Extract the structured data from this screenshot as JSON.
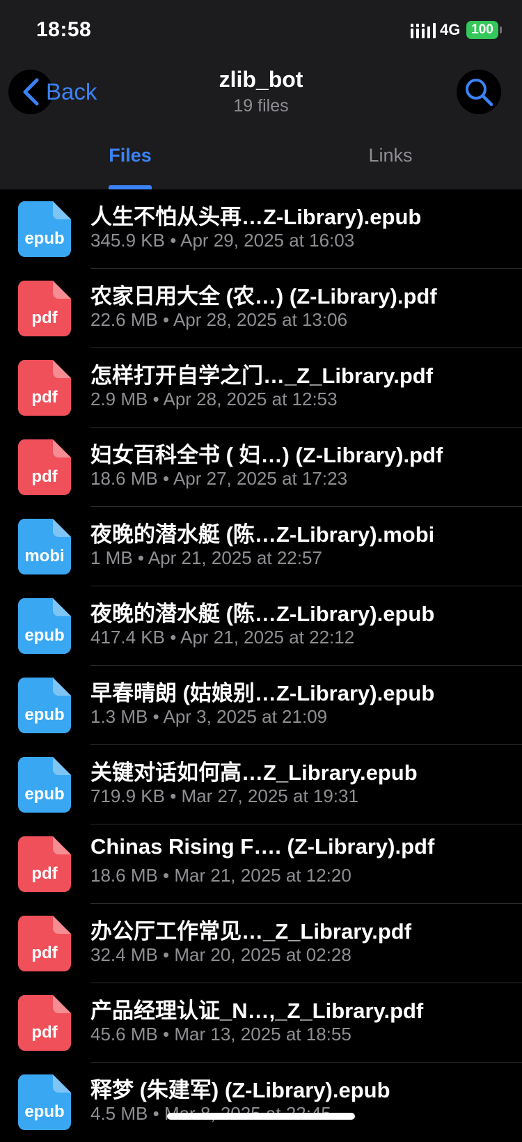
{
  "status_bar": {
    "time": "18:58",
    "network": "4G",
    "battery": "100"
  },
  "nav": {
    "back_label": "Back",
    "title": "zlib_bot",
    "subtitle": "19 files"
  },
  "tabs": [
    {
      "label": "Files",
      "active": true
    },
    {
      "label": "Links",
      "active": false
    }
  ],
  "colors": {
    "accent": "#3b82f6",
    "epub_icon": "#3aa7f2",
    "pdf_icon": "#f0505a"
  },
  "files": [
    {
      "ext": "epub",
      "name": "人生不怕从头再…Z-Library).epub",
      "size": "345.9 KB",
      "date": "Apr 29, 2025 at 16:03"
    },
    {
      "ext": "pdf",
      "name": "农家日用大全 (农…) (Z-Library).pdf",
      "size": "22.6 MB",
      "date": "Apr 28, 2025 at 13:06"
    },
    {
      "ext": "pdf",
      "name": "怎样打开自学之门…_Z_Library.pdf",
      "size": "2.9 MB",
      "date": "Apr 28, 2025 at 12:53"
    },
    {
      "ext": "pdf",
      "name": "妇女百科全书 ( 妇…) (Z-Library).pdf",
      "size": "18.6 MB",
      "date": "Apr 27, 2025 at 17:23"
    },
    {
      "ext": "mobi",
      "name": "夜晚的潜水艇 (陈…Z-Library).mobi",
      "size": "1 MB",
      "date": "Apr 21, 2025 at 22:57"
    },
    {
      "ext": "epub",
      "name": "夜晚的潜水艇 (陈…Z-Library).epub",
      "size": "417.4 KB",
      "date": "Apr 21, 2025 at 22:12"
    },
    {
      "ext": "epub",
      "name": "早春晴朗 (姑娘别…Z-Library).epub",
      "size": "1.3 MB",
      "date": "Apr 3, 2025 at 21:09"
    },
    {
      "ext": "epub",
      "name": "关键对话如何高…Z_Library.epub",
      "size": "719.9 KB",
      "date": "Mar 27, 2025 at 19:31"
    },
    {
      "ext": "pdf",
      "name": "Chinas Rising F…. (Z-Library).pdf",
      "size": "18.6 MB",
      "date": "Mar 21, 2025 at 12:20"
    },
    {
      "ext": "pdf",
      "name": "办公厅工作常见…_Z_Library.pdf",
      "size": "32.4 MB",
      "date": "Mar 20, 2025 at 02:28"
    },
    {
      "ext": "pdf",
      "name": "产品经理认证_N…,_Z_Library.pdf",
      "size": "45.6 MB",
      "date": "Mar 13, 2025 at 18:55"
    },
    {
      "ext": "epub",
      "name": "释梦 (朱建军) (Z-Library).epub",
      "size": "4.5 MB",
      "date": "Mar 8, 2025 at 22:45"
    }
  ]
}
